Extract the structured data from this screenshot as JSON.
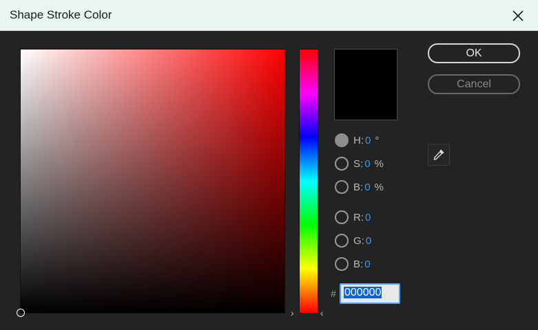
{
  "window": {
    "title": "Shape Stroke Color",
    "close_icon": "close-icon"
  },
  "buttons": {
    "ok": "OK",
    "cancel": "Cancel"
  },
  "picker": {
    "hue_degrees": 0,
    "saturation": 0,
    "brightness": 0,
    "preview_color": "#000000"
  },
  "fields": {
    "h": {
      "label": "H:",
      "value": "0",
      "unit": "°",
      "selected": true
    },
    "s": {
      "label": "S:",
      "value": "0",
      "unit": "%"
    },
    "b": {
      "label": "B:",
      "value": "0",
      "unit": "%"
    },
    "r": {
      "label": "R:",
      "value": "0"
    },
    "g": {
      "label": "G:",
      "value": "0"
    },
    "b2": {
      "label": "B:",
      "value": "0"
    }
  },
  "hex": {
    "hash": "#",
    "value": "000000"
  },
  "icons": {
    "eyedropper": "eyedropper-icon",
    "hue_left_arrow": "›",
    "hue_right_arrow": "‹"
  }
}
